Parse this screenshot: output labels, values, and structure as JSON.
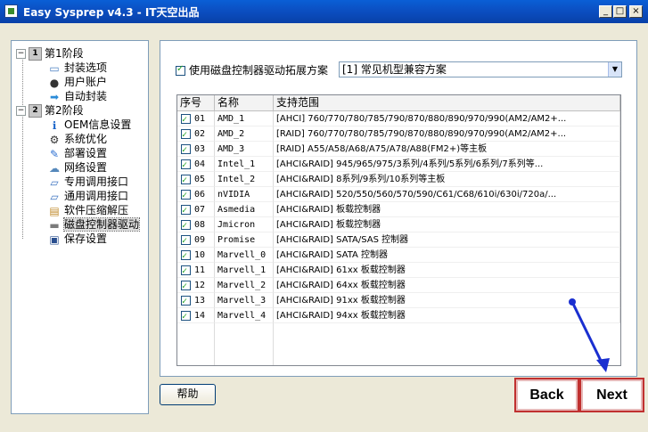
{
  "window": {
    "title": "Easy Sysprep v4.3 - IT天空出品",
    "min_glyph": "_",
    "max_glyph": "□",
    "close_glyph": "×"
  },
  "tree": {
    "stage1": {
      "num": "1",
      "label": "第1阶段"
    },
    "stage1_items": [
      {
        "label": "封装选项",
        "icon": "monitor-icon",
        "glyph": "▭",
        "color": "#4a7fc1"
      },
      {
        "label": "用户账户",
        "icon": "user-icon",
        "glyph": "●",
        "color": "#333"
      },
      {
        "label": "自动封装",
        "icon": "arrow-right-icon",
        "glyph": "➡",
        "color": "#2a8bd8"
      }
    ],
    "stage2": {
      "num": "2",
      "label": "第2阶段"
    },
    "stage2_items": [
      {
        "label": "OEM信息设置",
        "icon": "info-icon",
        "glyph": "ℹ",
        "color": "#1c66c9"
      },
      {
        "label": "系统优化",
        "icon": "gear-icon",
        "glyph": "⚙",
        "color": "#333"
      },
      {
        "label": "部署设置",
        "icon": "tools-icon",
        "glyph": "✎",
        "color": "#2c6fd1"
      },
      {
        "label": "网络设置",
        "icon": "network-icon",
        "glyph": "☁",
        "color": "#5588bb"
      },
      {
        "label": "专用调用接口",
        "icon": "interface-icon",
        "glyph": "▱",
        "color": "#3b72c0"
      },
      {
        "label": "通用调用接口",
        "icon": "interface-icon",
        "glyph": "▱",
        "color": "#3b72c0"
      },
      {
        "label": "软件压缩解压",
        "icon": "archive-icon",
        "glyph": "▤",
        "color": "#c08a2a"
      },
      {
        "label": "磁盘控制器驱动",
        "icon": "disk-icon",
        "glyph": "▬",
        "color": "#7a7a7a"
      },
      {
        "label": "保存设置",
        "icon": "save-icon",
        "glyph": "▣",
        "color": "#2a4f8f"
      }
    ]
  },
  "panel": {
    "option_label": "使用磁盘控制器驱动拓展方案",
    "option_checked": true,
    "combo_value": "[1] 常见机型兼容方案",
    "columns": {
      "num": "序号",
      "name": "名称",
      "scope": "支持范围"
    },
    "rows": [
      {
        "num": "01",
        "name": "AMD_1",
        "scope": "[AHCI] 760/770/780/785/790/870/880/890/970/990(AM2/AM2+..."
      },
      {
        "num": "02",
        "name": "AMD_2",
        "scope": "[RAID] 760/770/780/785/790/870/880/890/970/990(AM2/AM2+..."
      },
      {
        "num": "03",
        "name": "AMD_3",
        "scope": "[RAID] A55/A58/A68/A75/A78/A88(FM2+)等主板"
      },
      {
        "num": "04",
        "name": "Intel_1",
        "scope": "[AHCI&RAID] 945/965/975/3系列/4系列/5系列/6系列/7系列等..."
      },
      {
        "num": "05",
        "name": "Intel_2",
        "scope": "[AHCI&RAID] 8系列/9系列/10系列等主板"
      },
      {
        "num": "06",
        "name": "nVIDIA",
        "scope": "[AHCI&RAID] 520/550/560/570/590/C61/C68/610i/630i/720a/..."
      },
      {
        "num": "07",
        "name": "Asmedia",
        "scope": "[AHCI&RAID] 板载控制器"
      },
      {
        "num": "08",
        "name": "Jmicron",
        "scope": "[AHCI&RAID] 板载控制器"
      },
      {
        "num": "09",
        "name": "Promise",
        "scope": "[AHCI&RAID] SATA/SAS 控制器"
      },
      {
        "num": "10",
        "name": "Marvell_0",
        "scope": "[AHCI&RAID] SATA 控制器"
      },
      {
        "num": "11",
        "name": "Marvell_1",
        "scope": "[AHCI&RAID] 61xx 板载控制器"
      },
      {
        "num": "12",
        "name": "Marvell_2",
        "scope": "[AHCI&RAID] 64xx 板载控制器"
      },
      {
        "num": "13",
        "name": "Marvell_3",
        "scope": "[AHCI&RAID] 91xx 板载控制器"
      },
      {
        "num": "14",
        "name": "Marvell_4",
        "scope": "[AHCI&RAID] 94xx 板载控制器"
      }
    ]
  },
  "buttons": {
    "help": "帮助",
    "back": "Back",
    "next": "Next"
  },
  "colors": {
    "annotation_arrow": "#1a2fd0",
    "highlight_border": "#c0302f",
    "title_bar": "#0b4fc2"
  }
}
